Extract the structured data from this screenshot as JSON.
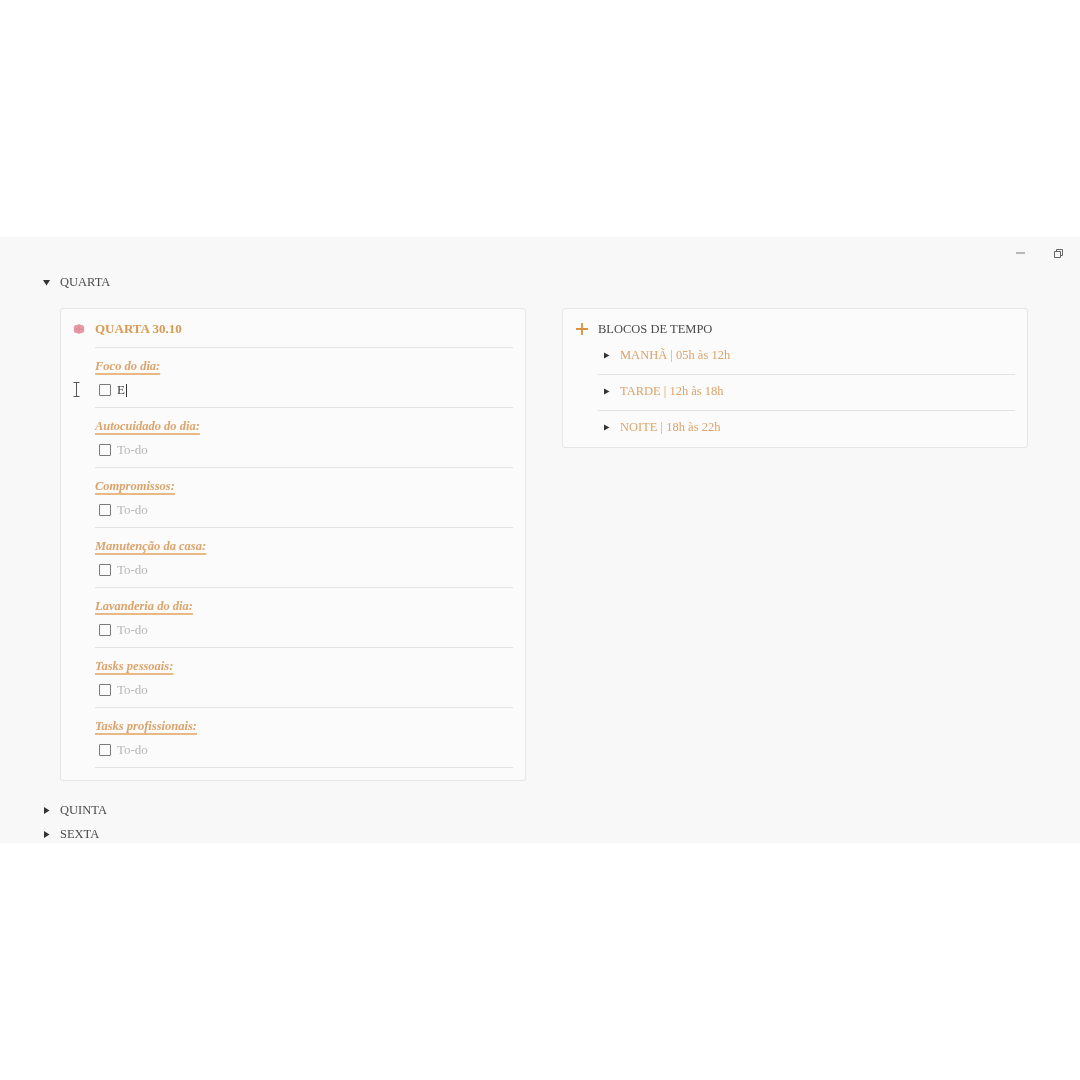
{
  "toggles": [
    {
      "label": "QUARTA",
      "expanded": true,
      "day_card": {
        "title": "QUARTA 30.10",
        "sections": [
          {
            "heading": "Foco do dia:",
            "todos": [
              {
                "checked": false,
                "value": "E",
                "focused": true
              }
            ]
          },
          {
            "heading": "Autocuidado do dia:",
            "todos": [
              {
                "checked": false,
                "placeholder": "To-do"
              }
            ]
          },
          {
            "heading": "Compromissos:",
            "todos": [
              {
                "checked": false,
                "placeholder": "To-do"
              }
            ]
          },
          {
            "heading": "Manutenção da casa:",
            "todos": [
              {
                "checked": false,
                "placeholder": "To-do"
              }
            ]
          },
          {
            "heading": "Lavanderia do dia:",
            "todos": [
              {
                "checked": false,
                "placeholder": "To-do"
              }
            ]
          },
          {
            "heading": "Tasks pessoais:",
            "todos": [
              {
                "checked": false,
                "placeholder": "To-do"
              }
            ]
          },
          {
            "heading": "Tasks profissionais:",
            "todos": [
              {
                "checked": false,
                "placeholder": "To-do"
              }
            ]
          }
        ]
      },
      "time_blocks": {
        "title": "BLOCOS DE TEMPO",
        "items": [
          {
            "label": "MANHÃ | 05h às 12h",
            "expanded": false
          },
          {
            "label": "TARDE | 12h às 18h",
            "expanded": false
          },
          {
            "label": "NOITE | 18h às 22h",
            "expanded": false
          }
        ]
      }
    },
    {
      "label": "QUINTA",
      "expanded": false
    },
    {
      "label": "SEXTA",
      "expanded": false
    }
  ]
}
